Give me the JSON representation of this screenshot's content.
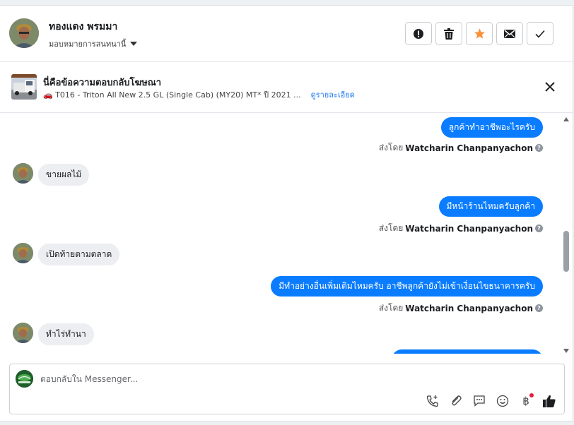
{
  "header": {
    "contact_name": "ทองแดง พรมมา",
    "assign_label": "มอบหมายการสนทนานี้",
    "actions": [
      {
        "name": "spam-button",
        "icon": "alert-circle-icon"
      },
      {
        "name": "delete-button",
        "icon": "trash-icon"
      },
      {
        "name": "star-button",
        "icon": "star-icon"
      },
      {
        "name": "mark-unread-button",
        "icon": "envelope-icon"
      },
      {
        "name": "mark-done-button",
        "icon": "checkmark-icon"
      }
    ]
  },
  "ad_context": {
    "title": "นี่คือข้อความตอบกลับโฆษณา",
    "description": "🚗 T016 - Triton All New 2.5 GL (Single Cab) (MY20) MT* ปี 2021 ...",
    "details_link": "ดูรายละเอียด"
  },
  "messages": [
    {
      "direction": "out",
      "text": "ลูกค้าทำอาชีพอะไรครับ",
      "sent_by_prefix": "ส่งโดย",
      "sender": "Watcharin Chanpanyachon"
    },
    {
      "direction": "in",
      "text": "ขายผลไม้"
    },
    {
      "direction": "out",
      "text": "มีหน้าร้านไหมครับลูกค้า",
      "sent_by_prefix": "ส่งโดย",
      "sender": "Watcharin Chanpanyachon"
    },
    {
      "direction": "in",
      "text": "เปิดท้ายตามตลาด"
    },
    {
      "direction": "out",
      "text": "มีทำอย่างอื่นเพิ่มเติมไหมครับ อาชีพลูกค้ายังไม่เข้าเงื่อนไขธนาคารครับ",
      "sent_by_prefix": "ส่งโดย",
      "sender": "Watcharin Chanpanyachon"
    },
    {
      "direction": "in",
      "text": "ทำไร่ทำนา"
    }
  ],
  "composer": {
    "placeholder": "ตอบกลับใน Messenger...",
    "tools": [
      "phone-add-icon",
      "paperclip-icon",
      "saved-reply-icon",
      "emoji-icon",
      "baht-payment-icon",
      "thumbs-up-icon"
    ],
    "baht_symbol": "฿"
  },
  "colors": {
    "outgoing_bubble": "#0a7cff",
    "incoming_bubble": "#eceef1",
    "star": "#f7923b"
  }
}
